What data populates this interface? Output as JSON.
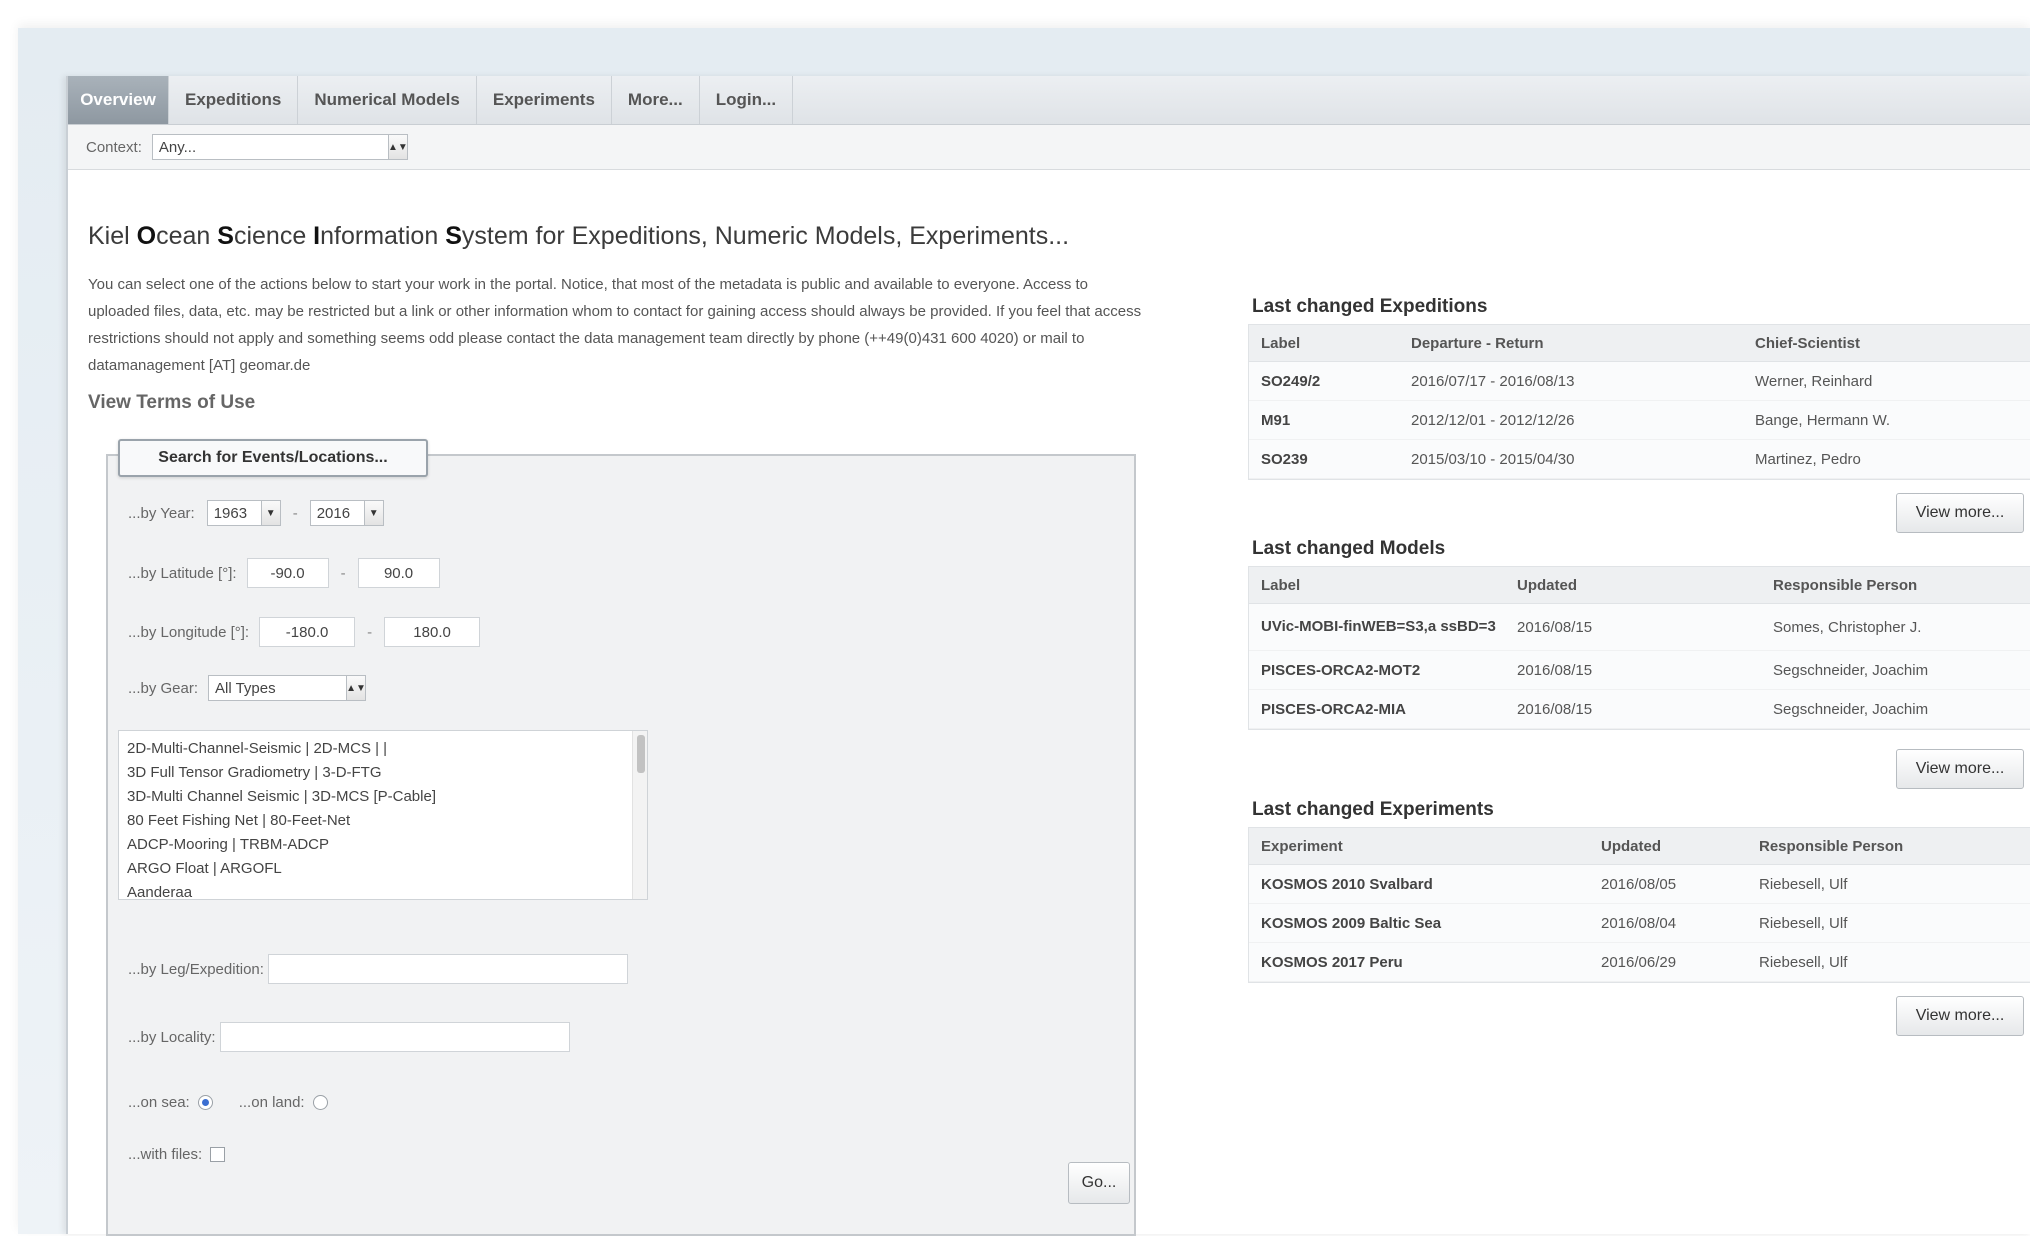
{
  "nav": {
    "tabs": [
      {
        "label": "Overview",
        "active": true
      },
      {
        "label": "Expeditions"
      },
      {
        "label": "Numerical Models"
      },
      {
        "label": "Experiments"
      },
      {
        "label": "More..."
      },
      {
        "label": "Login..."
      }
    ]
  },
  "context": {
    "label": "Context:",
    "value": "Any..."
  },
  "main": {
    "title_parts": [
      "Kiel ",
      "O",
      "cean ",
      "S",
      "cience ",
      "I",
      "nformation ",
      "S",
      "ystem for Expeditions, Numeric Models, Experiments..."
    ],
    "intro": "You can select one of the actions below to start your work in the portal. Notice, that most of the metadata is public and available to everyone. Access to uploaded files, data, etc. may be restricted but a link or other information whom to contact for gaining access should always be provided. If you feel that access restrictions should not apply and something seems odd please contact the data management team directly by phone (++49(0)431 600 4020) or mail to datamanagement [AT] geomar.de",
    "terms_link": "View Terms of Use"
  },
  "search": {
    "legend": "Search for Events/Locations...",
    "year_label": "...by Year:",
    "year_from": "1963",
    "year_to": "2016",
    "lat_label": "...by Latitude [°]:",
    "lat_min": "-90.0",
    "lat_max": "90.0",
    "lon_label": "...by Longitude [°]:",
    "lon_min": "-180.0",
    "lon_max": "180.0",
    "gear_label": "...by Gear:",
    "gear_type": "All Types",
    "gear_items": [
      "2D-Multi-Channel-Seismic | 2D-MCS | |",
      "3D Full Tensor Gradiometry | 3-D-FTG",
      "3D-Multi Channel Seismic | 3D-MCS [P-Cable]",
      "80 Feet Fishing Net | 80-Feet-Net",
      "ADCP-Mooring | TRBM-ADCP",
      "ARGO Float | ARGOFL",
      "Aanderaa"
    ],
    "leg_label": "...by Leg/Expedition:",
    "leg_value": "",
    "locality_label": "...by Locality:",
    "locality_value": "",
    "on_sea_label": "...on sea:",
    "on_land_label": "...on land:",
    "with_files_label": "...with files:",
    "go_label": "Go..."
  },
  "expeditions": {
    "title": "Last changed Expeditions",
    "columns": [
      "Label",
      "Departure - Return",
      "Chief-Scientist"
    ],
    "rows": [
      [
        "SO249/2",
        "2016/07/17 - 2016/08/13",
        "Werner, Reinhard"
      ],
      [
        "M91",
        "2012/12/01 - 2012/12/26",
        "Bange, Hermann W."
      ],
      [
        "SO239",
        "2015/03/10 - 2015/04/30",
        "Martinez, Pedro"
      ]
    ],
    "view_more": "View more..."
  },
  "models": {
    "title": "Last changed Models",
    "columns": [
      "Label",
      "Updated",
      "Responsible Person"
    ],
    "rows": [
      [
        "UVic-MOBI-finWEB=S3,a ssBD=3",
        "2016/08/15",
        "Somes, Christopher J."
      ],
      [
        "PISCES-ORCA2-MOT2",
        "2016/08/15",
        "Segschneider, Joachim"
      ],
      [
        "PISCES-ORCA2-MIA",
        "2016/08/15",
        "Segschneider, Joachim"
      ]
    ],
    "view_more": "View more..."
  },
  "experiments": {
    "title": "Last changed Experiments",
    "columns": [
      "Experiment",
      "Updated",
      "Responsible Person"
    ],
    "rows": [
      [
        "KOSMOS 2010 Svalbard",
        "2016/08/05",
        "Riebesell, Ulf"
      ],
      [
        "KOSMOS 2009 Baltic Sea",
        "2016/08/04",
        "Riebesell, Ulf"
      ],
      [
        "KOSMOS 2017 Peru",
        "2016/06/29",
        "Riebesell, Ulf"
      ]
    ],
    "view_more": "View more..."
  },
  "colors": {
    "active_tab": "#9aa3ab",
    "panel_bg": "#f1f2f3",
    "backdrop": "#e6edf3",
    "radio_selected": "#3b6fd1"
  },
  "icons": [
    "select-arrow-icon",
    "scrollbar-thumb"
  ]
}
